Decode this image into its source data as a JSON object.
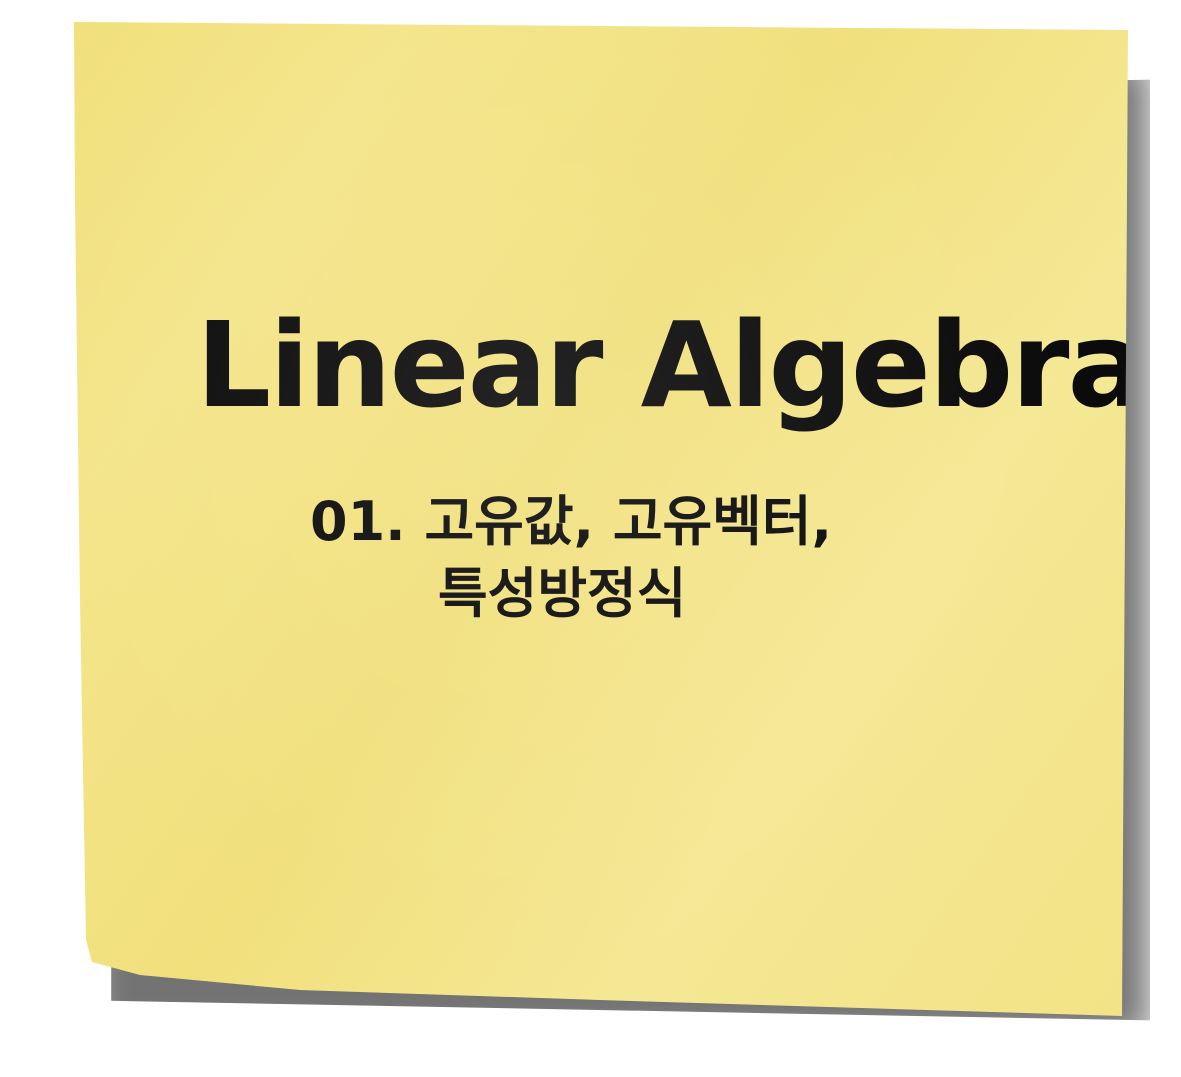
{
  "note": {
    "title": "Linear Algebra",
    "subtitle_line1": "01. 고유값, 고유벡터,",
    "subtitle_line2": "특성방정식",
    "background_color": "#f2e283",
    "text_color": "#0b0b0b"
  }
}
